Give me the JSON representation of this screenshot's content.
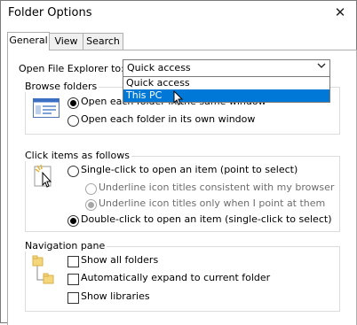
{
  "window": {
    "title": "Folder Options",
    "close_glyph": "✕"
  },
  "tabs": [
    {
      "label": "General",
      "active": true
    },
    {
      "label": "View",
      "active": false
    },
    {
      "label": "Search",
      "active": false
    }
  ],
  "open_explorer": {
    "label": "Open File Explorer to:",
    "selected": "Quick access",
    "options": [
      "Quick access",
      "This PC"
    ],
    "highlighted": "This PC"
  },
  "browse_folders": {
    "legend": "Browse folders",
    "options": [
      {
        "label": "Open each folder in the same window",
        "checked": true
      },
      {
        "label": "Open each folder in its own window",
        "checked": false
      }
    ]
  },
  "click_items": {
    "legend": "Click items as follows",
    "single_click": {
      "label": "Single-click to open an item (point to select)",
      "checked": false
    },
    "underline_options": [
      {
        "label": "Underline icon titles consistent with my browser",
        "checked": false,
        "disabled": true
      },
      {
        "label": "Underline icon titles only when I point at them",
        "checked": true,
        "disabled": true
      }
    ],
    "double_click": {
      "label": "Double-click to open an item (single-click to select)",
      "checked": true
    }
  },
  "navigation_pane": {
    "legend": "Navigation pane",
    "options": [
      {
        "label": "Show all folders",
        "checked": false
      },
      {
        "label": "Automatically expand to current folder",
        "checked": false
      },
      {
        "label": "Show libraries",
        "checked": false
      }
    ]
  },
  "colors": {
    "accent": "#0078d7",
    "folder": "#f5d67a"
  }
}
